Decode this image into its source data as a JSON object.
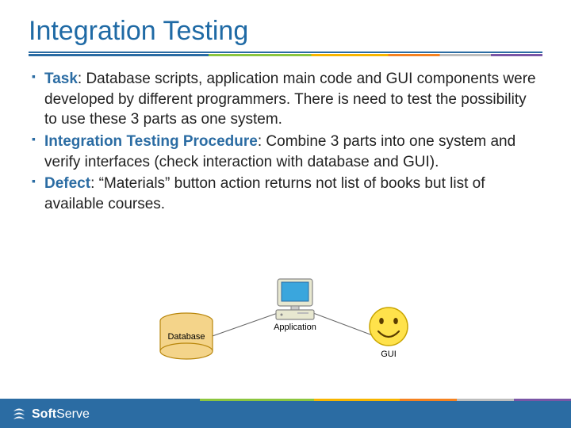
{
  "title": "Integration Testing",
  "bullets": [
    {
      "keyword": "Task",
      "text": ": Database scripts, application main code and GUI components were developed by different programmers. There is need to test the possibility to use these 3 parts as one system."
    },
    {
      "keyword": "Integration Testing Procedure",
      "text": ": Combine 3 parts into one system and verify interfaces (check interaction with database and GUI)."
    },
    {
      "keyword": "Defect",
      "text": ": “Materials” button action returns not list of books but list of available courses."
    }
  ],
  "diagram": {
    "database": "Database",
    "application": "Application",
    "gui": "GUI"
  },
  "brand": {
    "prefix": "Soft",
    "suffix": "Serve"
  }
}
